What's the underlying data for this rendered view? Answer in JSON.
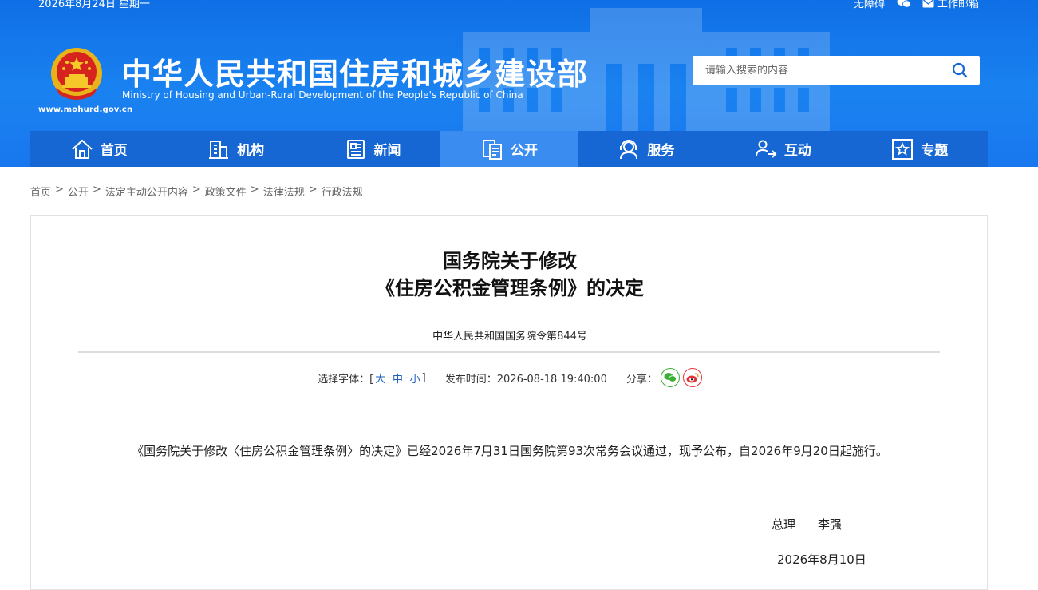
{
  "topbar": {
    "date": "2026年8月24日 星期一",
    "accessible": "无障碍",
    "mail": "工作邮箱"
  },
  "site": {
    "title_cn": "中华人民共和国住房和城乡建设部",
    "title_en": "Ministry of Housing and Urban-Rural Development of the People's Republic of China",
    "domain": "www.mohurd.gov.cn"
  },
  "search": {
    "placeholder": "请输入搜索的内容"
  },
  "nav": [
    {
      "label": "首页",
      "icon": "home-icon"
    },
    {
      "label": "机构",
      "icon": "building-icon"
    },
    {
      "label": "新闻",
      "icon": "newspaper-icon"
    },
    {
      "label": "公开",
      "icon": "document-icon"
    },
    {
      "label": "服务",
      "icon": "service-icon"
    },
    {
      "label": "互动",
      "icon": "interaction-icon"
    },
    {
      "label": "专题",
      "icon": "topic-star-icon"
    }
  ],
  "breadcrumb": [
    "首页",
    "公开",
    "法定主动公开内容",
    "政策文件",
    "法律法规",
    "行政法规"
  ],
  "breadcrumb_sep": ">",
  "article": {
    "title_line1": "国务院关于修改",
    "title_line2": "《住房公积金管理条例》的决定",
    "subtitle": "中华人民共和国国务院令第844号",
    "font_label": "选择字体：[",
    "font_close": "]",
    "font_large": "大",
    "font_medium": "中",
    "font_small": "小",
    "font_dash": "-",
    "publish_label": "发布时间：",
    "publish_time": "2026-08-18 19:40:00",
    "share_label": "分享：",
    "body": "《国务院关于修改〈住房公积金管理条例〉的决定》已经2026年7月31日国务院第93次常务会议通过，现予公布，自2026年9月20日起施行。",
    "signer_title": "总理",
    "signer_name": "李强",
    "sign_date": "2026年8月10日"
  },
  "colors": {
    "header_blue": "#1a82f0",
    "nav_blue": "#1667d3",
    "nav_active": "#3b8cf0",
    "wechat_green": "#3cb035",
    "weibo_red": "#e0353a"
  }
}
